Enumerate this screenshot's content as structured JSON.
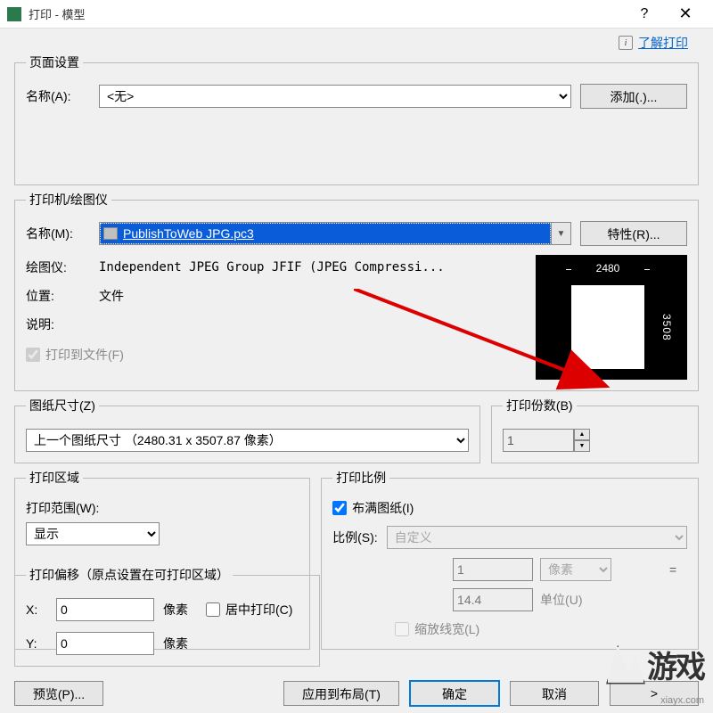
{
  "window": {
    "title": "打印 - 模型",
    "help_link": "了解打印"
  },
  "page_setup": {
    "legend": "页面设置",
    "name_label": "名称(A):",
    "name_value": "<无>",
    "add_button": "添加(.)..."
  },
  "printer": {
    "legend": "打印机/绘图仪",
    "name_label": "名称(M):",
    "name_value": "PublishToWeb JPG.pc3",
    "props_button": "特性(R)...",
    "plotter_label": "绘图仪:",
    "plotter_value": "Independent JPEG Group JFIF (JPEG Compressi...",
    "location_label": "位置:",
    "location_value": "文件",
    "desc_label": "说明:",
    "desc_value": "",
    "to_file_label": "打印到文件(F)",
    "preview_width": "2480",
    "preview_height": "3508"
  },
  "paper": {
    "legend": "图纸尺寸(Z)",
    "value": "上一个图纸尺寸 （2480.31 x 3507.87 像素）"
  },
  "copies": {
    "legend": "打印份数(B)",
    "value": "1"
  },
  "area": {
    "legend": "打印区域",
    "range_label": "打印范围(W):",
    "range_value": "显示"
  },
  "scale": {
    "legend": "打印比例",
    "fit_label": "布满图纸(I)",
    "scale_label": "比例(S):",
    "scale_value": "自定义",
    "unit1_value": "1",
    "unit1_label": "像素",
    "unit2_value": "14.4",
    "unit2_label": "单位(U)",
    "lineweights_label": "缩放线宽(L)"
  },
  "offset": {
    "legend": "打印偏移（原点设置在可打印区域）",
    "x_label": "X:",
    "x_value": "0",
    "y_label": "Y:",
    "y_value": "0",
    "unit": "像素",
    "center_label": "居中打印(C)"
  },
  "footer": {
    "preview": "预览(P)...",
    "apply": "应用到布局(T)",
    "ok": "确定",
    "cancel": "取消",
    "watermark_url": "xiayx.com",
    "watermark_text": "游戏"
  }
}
